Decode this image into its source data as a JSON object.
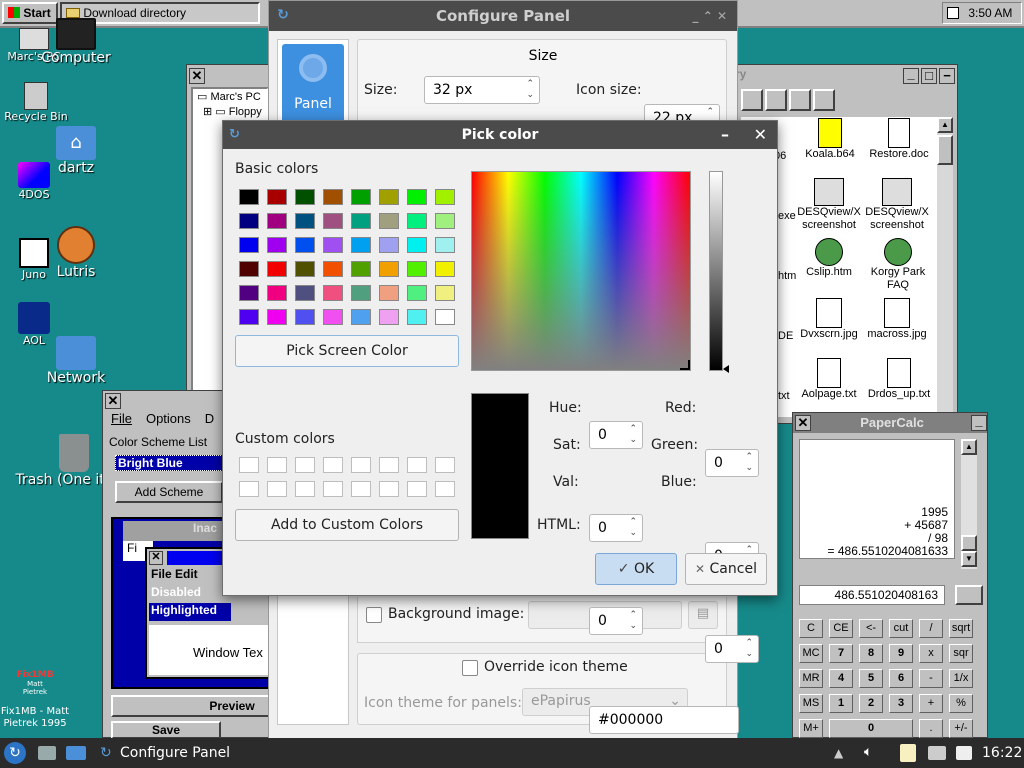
{
  "topbar": {
    "start": "Start",
    "task": "Download directory",
    "clock": "3:50 AM"
  },
  "desktop_icons": [
    {
      "label": "Marc's PC"
    },
    {
      "label": "Computer"
    },
    {
      "label": "Recycle Bin"
    },
    {
      "label": "4DOS"
    },
    {
      "label": "dartz"
    },
    {
      "label": "Juno"
    },
    {
      "label": "Lutris"
    },
    {
      "label": "AOL"
    },
    {
      "label": "Network"
    },
    {
      "label": "Trash (One item)"
    }
  ],
  "fixnote": {
    "line1": "Fix1MB - Matt",
    "line2": "Pietrek 1995",
    "brand": "Fix1MB",
    "by1": "Matt",
    "by2": "Pietrek"
  },
  "explorer": {
    "title": "ry",
    "tree": [
      "Marc's PC",
      "Floppy"
    ],
    "files": [
      {
        "name": "Koala.b64"
      },
      {
        "name": "Restore.doc"
      },
      {
        "name": "DESQview/X screenshot"
      },
      {
        "name": "DESQview/X screenshot"
      },
      {
        "name": "Cslip.htm"
      },
      {
        "name": "Korgy Park FAQ"
      },
      {
        "name": "Dvxscrn.jpg"
      },
      {
        "name": "macross.jpg"
      },
      {
        "name": "Aolpage.txt"
      },
      {
        "name": "Drdos_up.txt"
      }
    ],
    "cut_labels": [
      "06",
      "exe",
      "htm",
      "DE",
      "txt",
      "zip"
    ]
  },
  "color_scheme": {
    "menu": [
      "File",
      "Options",
      "D"
    ],
    "group_label": "Color Scheme List",
    "selected": "Bright Blue",
    "add_button": "Add Scheme",
    "inactive_title": "Inac",
    "fi": "Fi",
    "preview_menu": "File  Edit",
    "disabled": "Disabled",
    "highlighted": "Highlighted",
    "window_text": "Window Tex",
    "preview_button": "Preview",
    "save_button": "Save"
  },
  "config_panel": {
    "title": "Configure Panel",
    "sidebar_item": "Panel",
    "size_group": "Size",
    "size_label": "Size:",
    "size_value": "32 px",
    "icon_size_label": "Icon size:",
    "icon_size_value": "22 px",
    "bg_image_label": "Background image:",
    "override_icon_theme": "Override icon theme",
    "icon_theme_label": "Icon theme for panels:",
    "icon_theme_value": "ePapirus"
  },
  "pick_color": {
    "title": "Pick color",
    "basic_colors_label": "Basic colors",
    "basic_colors": [
      "#000000",
      "#a80000",
      "#005000",
      "#a05000",
      "#00a000",
      "#a0a000",
      "#00f000",
      "#a0f000",
      "#000080",
      "#a00080",
      "#005080",
      "#a05080",
      "#00a080",
      "#a0a080",
      "#00f080",
      "#a0f080",
      "#0000f0",
      "#a000f0",
      "#0050f0",
      "#a050f0",
      "#00a0f0",
      "#a0a0f0",
      "#00f0f0",
      "#a0f0f0",
      "#500000",
      "#f00000",
      "#505000",
      "#f05000",
      "#50a000",
      "#f0a000",
      "#50f000",
      "#f0f000",
      "#500080",
      "#f00080",
      "#505080",
      "#f05080",
      "#50a080",
      "#f0a080",
      "#50f080",
      "#f0f080",
      "#5000f0",
      "#f000f0",
      "#5050f0",
      "#f050f0",
      "#50a0f0",
      "#f0a0f0",
      "#50f0f0",
      "#ffffff"
    ],
    "pick_screen_button": "Pick Screen Color",
    "custom_colors_label": "Custom colors",
    "add_custom_button": "Add to Custom Colors",
    "hue_label": "Hue:",
    "hue": "0",
    "sat_label": "Sat:",
    "sat": "0",
    "val_label": "Val:",
    "val": "0",
    "red_label": "Red:",
    "red": "0",
    "green_label": "Green:",
    "green": "0",
    "blue_label": "Blue:",
    "blue": "0",
    "html_label": "HTML:",
    "html_value": "#000000",
    "ok_button": "OK",
    "cancel_button": "Cancel",
    "current_color": "#000000"
  },
  "papercalc": {
    "title": "PaperCalc",
    "tape": [
      "1995",
      "+ 45687",
      "/ 98",
      "= 486.5510204081633"
    ],
    "display": "486.551020408163",
    "keys": [
      [
        "C",
        "CE",
        "<-",
        "cut",
        "/",
        "sqrt"
      ],
      [
        "MC",
        "7",
        "8",
        "9",
        "x",
        "sqr"
      ],
      [
        "MR",
        "4",
        "5",
        "6",
        "-",
        "1/x"
      ],
      [
        "MS",
        "1",
        "2",
        "3",
        "+",
        "%"
      ],
      [
        "M+",
        "0",
        "",
        "",
        ".",
        "+/-"
      ]
    ]
  },
  "taskbar": {
    "task": "Configure Panel",
    "clock": "16:22"
  }
}
